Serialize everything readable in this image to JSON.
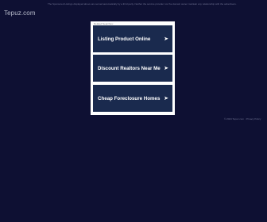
{
  "site": {
    "name": "Tepuz.com"
  },
  "notice": {
    "text": "The Sponsored Listings displayed above are served automatically by a third party. Neither the service provider nor the domain owner maintain any relationship with the advertisers."
  },
  "panel": {
    "caption": "Related Searches:",
    "links": [
      {
        "label": "Listing Product Online",
        "icon": "arrow-right-icon"
      },
      {
        "label": "Discount Realtors Near Me",
        "icon": "arrow-right-icon"
      },
      {
        "label": "Cheap Foreclosure Homes",
        "icon": "arrow-right-icon"
      }
    ]
  },
  "footer": {
    "text": "© 2024 Tepuz.com · Privacy Policy"
  },
  "colors": {
    "background": "#0e1033",
    "button": "#1a2a4e",
    "panel": "#ffffff",
    "text_light": "#b8bccc"
  }
}
